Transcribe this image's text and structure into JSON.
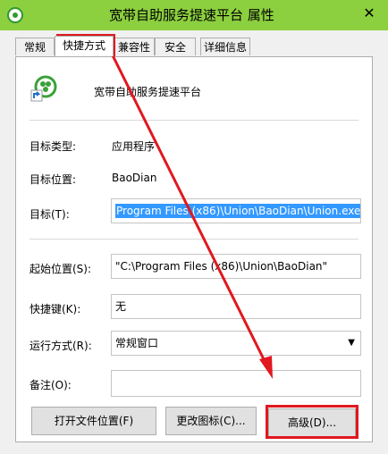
{
  "window": {
    "title": "宽带自助服务提速平台 属性",
    "close_glyph": "✕"
  },
  "tabs": [
    {
      "label": "常规",
      "active": false
    },
    {
      "label": "快捷方式",
      "active": true
    },
    {
      "label": "兼容性",
      "active": false
    },
    {
      "label": "安全",
      "active": false
    },
    {
      "label": "详细信息",
      "active": false
    }
  ],
  "shortcut": {
    "name": "宽带自助服务提速平台",
    "target_type_label": "目标类型:",
    "target_type_value": "应用程序",
    "target_location_label": "目标位置:",
    "target_location_value": "BaoDian",
    "target_label": "目标(T):",
    "target_value": "Program Files (x86)\\Union\\BaoDian\\Union.exe\"",
    "start_in_label": "起始位置(S):",
    "start_in_value": "\"C:\\Program Files (x86)\\Union\\BaoDian\"",
    "hotkey_label": "快捷键(K):",
    "hotkey_value": "无",
    "run_label": "运行方式(R):",
    "run_value": "常规窗口",
    "comment_label": "备注(O):",
    "comment_value": ""
  },
  "buttons": {
    "open_location": "打开文件位置(F)",
    "change_icon": "更改图标(C)...",
    "advanced": "高级(D)..."
  },
  "colors": {
    "titlebar": "#8ccf3f",
    "highlight": "#e0181f",
    "selection": "#3399ff"
  },
  "icons": {
    "app": "app-logo-icon",
    "close": "close-icon",
    "dropdown": "chevron-down-icon"
  }
}
